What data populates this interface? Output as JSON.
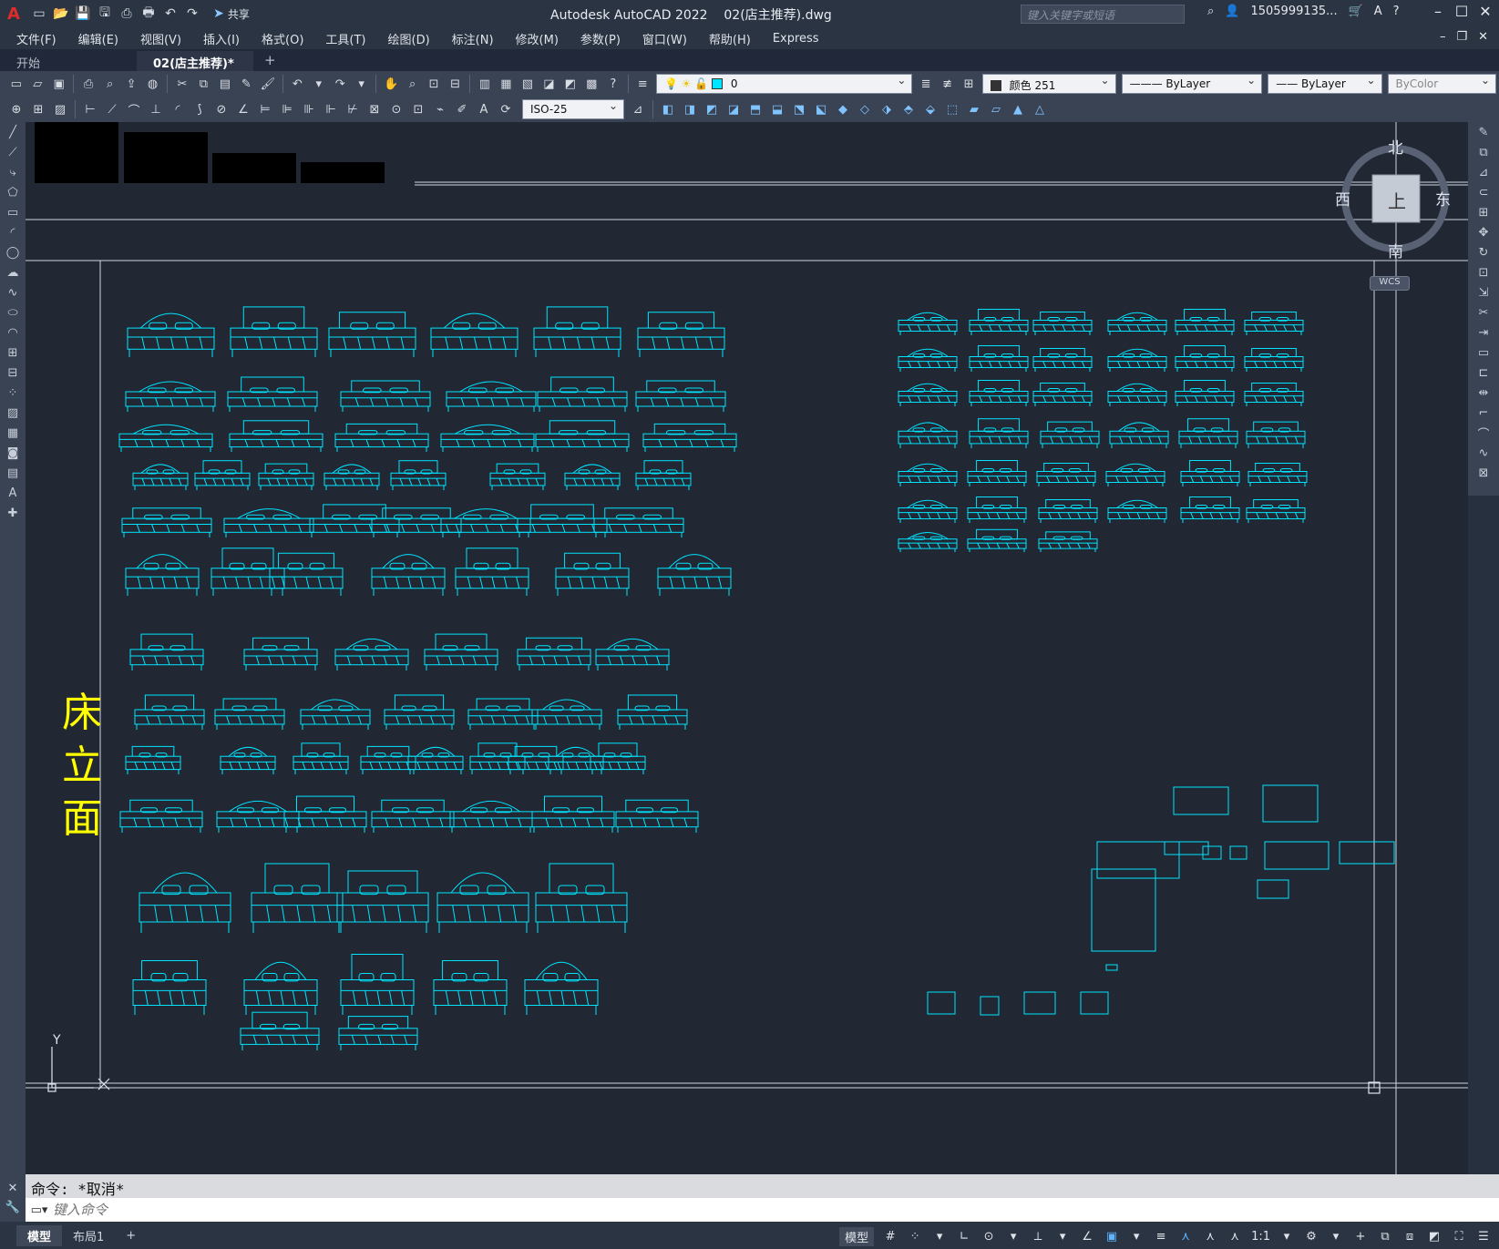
{
  "titlebar": {
    "app_name": "Autodesk AutoCAD 2022",
    "file_name": "02(店主推荐).dwg",
    "share_label": "共享",
    "search_placeholder": "键入关键字或短语",
    "user_name": "1505999135...",
    "window_controls": [
      "minimize",
      "restore",
      "close"
    ]
  },
  "menu": {
    "items": [
      "文件(F)",
      "编辑(E)",
      "视图(V)",
      "插入(I)",
      "格式(O)",
      "工具(T)",
      "绘图(D)",
      "标注(N)",
      "修改(M)",
      "参数(P)",
      "窗口(W)",
      "帮助(H)",
      "Express"
    ]
  },
  "tabs": {
    "items": [
      {
        "label": "开始",
        "active": false
      },
      {
        "label": "02(店主推荐)*",
        "active": true
      }
    ],
    "close_glyph": "✕",
    "add_glyph": "+"
  },
  "toolbar": {
    "layer_value": "0",
    "color_value": "颜色 251",
    "linetype_value": "ByLayer",
    "lineweight_value": "ByLayer",
    "plotstyle_value": "ByColor",
    "dimstyle_value": "ISO-25"
  },
  "viewcube": {
    "north": "北",
    "south": "南",
    "east": "东",
    "west": "西",
    "top_face": "上",
    "wcs": "WCS"
  },
  "drawing": {
    "side_title": "床立面",
    "ucs_y": "Y",
    "accent_color": "#00e5ff",
    "title_color": "#ffff00"
  },
  "command": {
    "history": "命令: *取消*",
    "placeholder": "键入命令"
  },
  "status": {
    "layout_tabs": [
      "模型",
      "布局1"
    ],
    "add_layout": "+",
    "model_label": "模型",
    "scale_label": "1:1"
  }
}
